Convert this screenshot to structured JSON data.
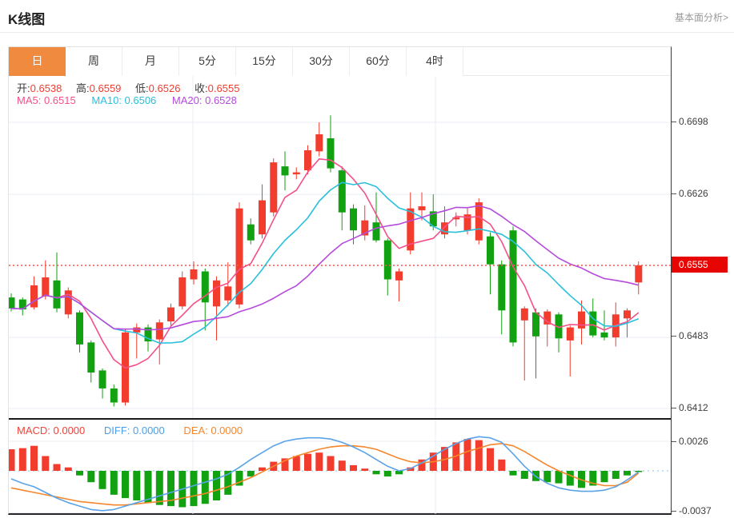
{
  "header": {
    "title": "K线图",
    "analysis_link": "基本面分析>"
  },
  "tabs": {
    "items": [
      "日",
      "周",
      "月",
      "5分",
      "15分",
      "30分",
      "60分",
      "4时"
    ],
    "active": "日",
    "active_color": "#f08a3e"
  },
  "ohlc": {
    "open_label": "开:",
    "open": "0.6538",
    "high_label": "高:",
    "high": "0.6559",
    "low_label": "低:",
    "low": "0.6526",
    "close_label": "收:",
    "close": "0.6555"
  },
  "ma_labels": {
    "ma5": "MA5: 0.6515",
    "ma10": "MA10: 0.6506",
    "ma20": "MA20: 0.6528"
  },
  "macd_labels": {
    "macd": "MACD: 0.0000",
    "diff": "DIFF: 0.0000",
    "dea": "DEA: 0.0000"
  },
  "axis": {
    "price_ticks": [
      {
        "label": "0.6698"
      },
      {
        "label": "0.6626"
      },
      {
        "label": "0.6483"
      },
      {
        "label": "0.6412"
      }
    ],
    "current_price": "0.6555",
    "macd_ticks": [
      {
        "label": "0.0026"
      },
      {
        "label": "-0.0037"
      }
    ]
  },
  "colors": {
    "up": "#f23c2e",
    "down": "#11a111",
    "doji": "#f8837a",
    "ma5": "#f5508a",
    "ma10": "#29c0dc",
    "ma20": "#b44bdc",
    "diff_line": "#5ba3e8",
    "dea_line": "#f5862b",
    "grid": "#e8eef4",
    "dotted_price_line": "#f4574d",
    "dotted_zero_line": "#aed6f1",
    "badge_bg": "#e60500"
  },
  "chart_data": {
    "type": "candlestick",
    "note": "daily K-line with MA5/MA10/MA20 overlays and MACD sub-panel; no x-axis labels visible",
    "price_axis": {
      "min": 0.6412,
      "max": 0.6698,
      "ticks": [
        0.6698,
        0.6626,
        0.6555,
        0.6483,
        0.6412
      ],
      "current": 0.6555
    },
    "macd_axis": {
      "ticks": [
        0.0026,
        -0.0037
      ],
      "zero_line_dotted": true
    },
    "ma_periods": [
      5,
      10,
      20
    ],
    "candles_ohlc": [
      [
        0.6523,
        0.6527,
        0.6509,
        0.6512
      ],
      [
        0.6521,
        0.6523,
        0.6505,
        0.6511
      ],
      [
        0.6513,
        0.6544,
        0.6511,
        0.6535
      ],
      [
        0.6524,
        0.656,
        0.6521,
        0.6543
      ],
      [
        0.654,
        0.6568,
        0.6508,
        0.6512
      ],
      [
        0.6506,
        0.6533,
        0.6502,
        0.653
      ],
      [
        0.6508,
        0.651,
        0.6468,
        0.6476
      ],
      [
        0.6478,
        0.648,
        0.6438,
        0.6448
      ],
      [
        0.645,
        0.6452,
        0.6422,
        0.6432
      ],
      [
        0.6432,
        0.6436,
        0.6414,
        0.6418
      ],
      [
        0.6418,
        0.6492,
        0.6415,
        0.6488
      ],
      [
        0.6488,
        0.6497,
        0.6462,
        0.6493
      ],
      [
        0.6493,
        0.6496,
        0.6469,
        0.6479
      ],
      [
        0.6481,
        0.6501,
        0.6456,
        0.6498
      ],
      [
        0.6499,
        0.6517,
        0.6495,
        0.6513
      ],
      [
        0.6514,
        0.6549,
        0.6511,
        0.6543
      ],
      [
        0.6541,
        0.6559,
        0.6536,
        0.6551
      ],
      [
        0.6549,
        0.6552,
        0.649,
        0.6518
      ],
      [
        0.6514,
        0.6544,
        0.648,
        0.654
      ],
      [
        0.652,
        0.6558,
        0.6514,
        0.6534
      ],
      [
        0.6516,
        0.6618,
        0.6512,
        0.6612
      ],
      [
        0.6596,
        0.6602,
        0.6576,
        0.658
      ],
      [
        0.6586,
        0.6636,
        0.6582,
        0.662
      ],
      [
        0.6608,
        0.6662,
        0.6604,
        0.6658
      ],
      [
        0.6654,
        0.6669,
        0.663,
        0.6645
      ],
      [
        0.6646,
        0.6653,
        0.6641,
        0.6648
      ],
      [
        0.665,
        0.6675,
        0.6646,
        0.667
      ],
      [
        0.6669,
        0.6698,
        0.6664,
        0.6686
      ],
      [
        0.6682,
        0.6705,
        0.6648,
        0.6652
      ],
      [
        0.665,
        0.6654,
        0.659,
        0.6608
      ],
      [
        0.6612,
        0.6616,
        0.6576,
        0.659
      ],
      [
        0.6585,
        0.6615,
        0.658,
        0.66
      ],
      [
        0.6598,
        0.6628,
        0.6578,
        0.658
      ],
      [
        0.658,
        0.6582,
        0.6525,
        0.6541
      ],
      [
        0.654,
        0.6552,
        0.6519,
        0.6549
      ],
      [
        0.657,
        0.6628,
        0.6566,
        0.6612
      ],
      [
        0.661,
        0.6628,
        0.66,
        0.6614
      ],
      [
        0.6609,
        0.6626,
        0.659,
        0.6594
      ],
      [
        0.6586,
        0.6614,
        0.6582,
        0.6598
      ],
      [
        0.6601,
        0.6608,
        0.6594,
        0.6603
      ],
      [
        0.659,
        0.6612,
        0.6586,
        0.6606
      ],
      [
        0.658,
        0.6622,
        0.6576,
        0.6618
      ],
      [
        0.6584,
        0.6588,
        0.6526,
        0.6556
      ],
      [
        0.6556,
        0.656,
        0.6486,
        0.651
      ],
      [
        0.659,
        0.6594,
        0.6474,
        0.6478
      ],
      [
        0.65,
        0.6514,
        0.644,
        0.6512
      ],
      [
        0.6508,
        0.6512,
        0.6442,
        0.6484
      ],
      [
        0.6496,
        0.6511,
        0.6474,
        0.6509
      ],
      [
        0.6506,
        0.6508,
        0.6468,
        0.6482
      ],
      [
        0.648,
        0.6495,
        0.6444,
        0.6493
      ],
      [
        0.6492,
        0.652,
        0.6476,
        0.6509
      ],
      [
        0.6509,
        0.6522,
        0.6483,
        0.6485
      ],
      [
        0.6488,
        0.651,
        0.648,
        0.6483
      ],
      [
        0.6483,
        0.6518,
        0.6474,
        0.6506
      ],
      [
        0.6502,
        0.6512,
        0.6483,
        0.651
      ],
      [
        0.6538,
        0.6559,
        0.6526,
        0.6555
      ]
    ],
    "macd": {
      "hist": [
        0.0019,
        0.002,
        0.0022,
        0.0013,
        0.0006,
        0.0003,
        -0.0004,
        -0.001,
        -0.0016,
        -0.0021,
        -0.0024,
        -0.0026,
        -0.0028,
        -0.003,
        -0.0031,
        -0.0032,
        -0.0031,
        -0.0029,
        -0.0026,
        -0.0021,
        -0.0013,
        -0.0005,
        0.0003,
        0.0008,
        0.0011,
        0.0013,
        0.0015,
        0.0016,
        0.0013,
        0.0009,
        0.0005,
        0.0002,
        -0.0003,
        -0.0005,
        -0.0003,
        0.0003,
        0.001,
        0.0016,
        0.0021,
        0.0025,
        0.0028,
        0.0027,
        0.002,
        0.001,
        -0.0004,
        -0.0007,
        -0.0009,
        -0.001,
        -0.0011,
        -0.0013,
        -0.0015,
        -0.0013,
        -0.001,
        -0.0007,
        -0.0004,
        -0.0001
      ],
      "diff": [
        -0.0007,
        -0.0011,
        -0.0014,
        -0.0019,
        -0.0024,
        -0.0028,
        -0.0031,
        -0.0034,
        -0.0035,
        -0.0034,
        -0.0031,
        -0.0028,
        -0.0025,
        -0.0022,
        -0.0019,
        -0.0016,
        -0.0013,
        -0.001,
        -0.0007,
        -0.0003,
        0.0003,
        0.001,
        0.0016,
        0.0022,
        0.0026,
        0.0028,
        0.0029,
        0.0029,
        0.0028,
        0.0025,
        0.0021,
        0.0016,
        0.001,
        0.0004,
        0.0,
        0.0002,
        0.0007,
        0.0013,
        0.0019,
        0.0024,
        0.0028,
        0.003,
        0.0029,
        0.0025,
        0.0015,
        0.0004,
        -0.0005,
        -0.0011,
        -0.0015,
        -0.0017,
        -0.0018,
        -0.0018,
        -0.0017,
        -0.0014,
        -0.0008,
        -0.0001
      ],
      "dea": [
        -0.0015,
        -0.0017,
        -0.0019,
        -0.0021,
        -0.0023,
        -0.0025,
        -0.0027,
        -0.0028,
        -0.0029,
        -0.003,
        -0.003,
        -0.0029,
        -0.0028,
        -0.0027,
        -0.0026,
        -0.0024,
        -0.0022,
        -0.002,
        -0.0017,
        -0.0014,
        -0.001,
        -0.0006,
        -0.0001,
        0.0004,
        0.0009,
        0.0013,
        0.0016,
        0.0019,
        0.0021,
        0.0022,
        0.0022,
        0.0021,
        0.0019,
        0.0015,
        0.0011,
        0.0008,
        0.0007,
        0.0008,
        0.001,
        0.0013,
        0.0017,
        0.002,
        0.0023,
        0.0024,
        0.0022,
        0.0017,
        0.0011,
        0.0005,
        0.0,
        -0.0004,
        -0.0008,
        -0.0011,
        -0.0013,
        -0.0013,
        -0.001,
        -0.0002
      ]
    }
  }
}
